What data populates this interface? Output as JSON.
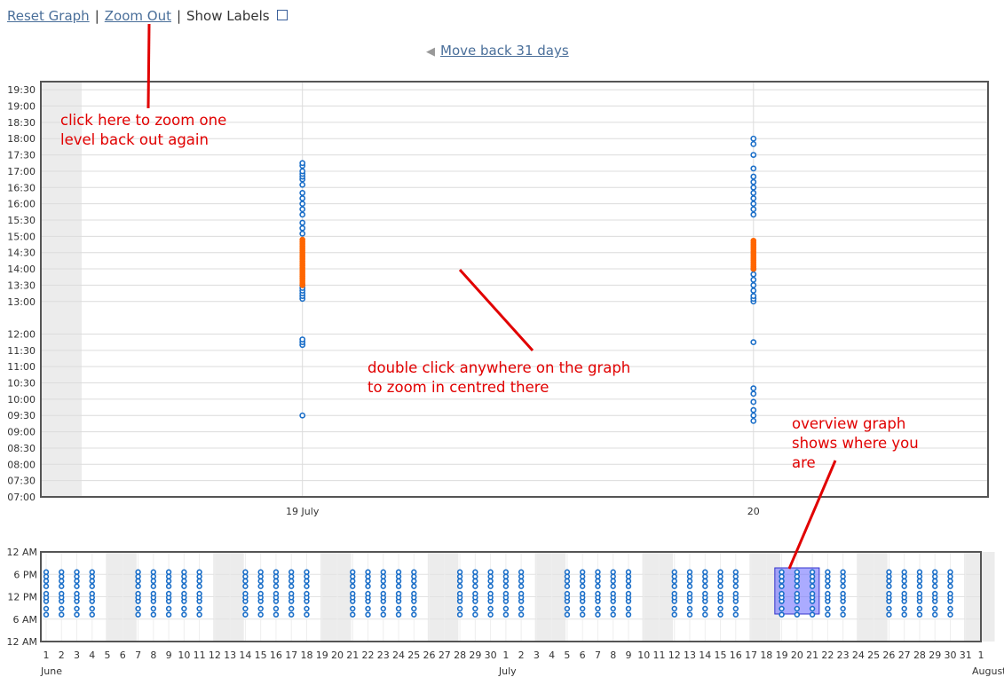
{
  "toolbar": {
    "reset_label": "Reset Graph",
    "zoom_out_label": "Zoom Out",
    "separator": "|",
    "show_labels_label": "Show Labels"
  },
  "navigation": {
    "move_back_label": "Move back 31 days"
  },
  "annotations": {
    "zoom_out_note": [
      "click here to zoom one",
      "level back out again"
    ],
    "double_click_note": [
      "double click anywhere on the graph",
      "to zoom in centred there"
    ],
    "overview_note": [
      "overview graph",
      "shows where you",
      "are"
    ]
  },
  "colors": {
    "point": "#1a6ec8",
    "highlight": "#ff6600",
    "annotation": "#e10000",
    "weekend_shade": "#ececec",
    "selection": "#6666ff"
  },
  "chart_data": [
    {
      "type": "scatter",
      "name_hint": "main",
      "title": "",
      "y_ticks": [
        "19:30",
        "19:00",
        "18:30",
        "18:00",
        "17:30",
        "17:00",
        "16:30",
        "16:00",
        "15:30",
        "15:00",
        "14:30",
        "14:00",
        "13:30",
        "13:00",
        "12:00",
        "11:30",
        "11:00",
        "10:30",
        "10:00",
        "09:30",
        "09:00",
        "08:30",
        "08:00",
        "07:30",
        "07:00"
      ],
      "x_ticks": [
        {
          "label": "19 July",
          "day": 19
        },
        {
          "label": "20",
          "day": 20
        }
      ],
      "xlim": [
        18.42,
        20.52
      ],
      "ylim": [
        "07:00",
        "19:45"
      ],
      "series": [
        {
          "day": 19,
          "blue": [
            "09:30",
            "11:40",
            "11:45",
            "11:50",
            "13:05",
            "13:10",
            "13:15",
            "13:20",
            "13:25",
            "13:30",
            "15:05",
            "15:15",
            "15:25",
            "15:40",
            "15:50",
            "16:00",
            "16:10",
            "16:20",
            "16:35",
            "16:45",
            "16:50",
            "16:55",
            "17:00",
            "17:10",
            "17:15"
          ],
          "orange_range": [
            "13:30",
            "14:55"
          ]
        },
        {
          "day": 20,
          "blue": [
            "09:20",
            "09:30",
            "09:40",
            "09:55",
            "10:10",
            "10:20",
            "11:45",
            "13:00",
            "13:05",
            "13:10",
            "13:20",
            "13:30",
            "13:40",
            "13:50",
            "14:00",
            "15:40",
            "15:50",
            "16:00",
            "16:10",
            "16:20",
            "16:30",
            "16:40",
            "16:50",
            "17:05",
            "17:30",
            "17:50",
            "18:00"
          ],
          "orange_range": [
            "14:00",
            "14:55"
          ]
        }
      ]
    },
    {
      "type": "scatter",
      "name_hint": "overview",
      "y_ticks": [
        "12 AM",
        "6 PM",
        "12 PM",
        "6 AM",
        "12 AM"
      ],
      "day_labels": [
        "1",
        "2",
        "3",
        "4",
        "5",
        "6",
        "7",
        "8",
        "9",
        "10",
        "11",
        "12",
        "13",
        "14",
        "15",
        "16",
        "17",
        "18",
        "19",
        "20",
        "21",
        "22",
        "23",
        "24",
        "25",
        "26",
        "27",
        "28",
        "29",
        "30",
        "1",
        "2",
        "3",
        "4",
        "5",
        "6",
        "7",
        "8",
        "9",
        "10",
        "11",
        "12",
        "13",
        "14",
        "15",
        "16",
        "17",
        "18",
        "19",
        "20",
        "21",
        "22",
        "23",
        "24",
        "25",
        "26",
        "27",
        "28",
        "29",
        "30",
        "31",
        "1"
      ],
      "month_labels": [
        {
          "label": "June",
          "index": 0
        },
        {
          "label": "July",
          "index": 30
        },
        {
          "label": "August",
          "index": 61
        }
      ],
      "weekend_indices": [
        4,
        11,
        18,
        25,
        32,
        39,
        46,
        53,
        60
      ],
      "data_days": [
        0,
        1,
        2,
        3,
        6,
        7,
        8,
        9,
        10,
        13,
        14,
        15,
        16,
        17,
        20,
        21,
        22,
        23,
        24,
        27,
        28,
        29,
        30,
        31,
        34,
        35,
        36,
        37,
        38,
        41,
        42,
        43,
        44,
        45,
        48,
        49,
        50,
        51,
        52,
        55,
        56,
        57,
        58,
        59
      ],
      "selected_range": [
        48,
        50
      ]
    }
  ]
}
